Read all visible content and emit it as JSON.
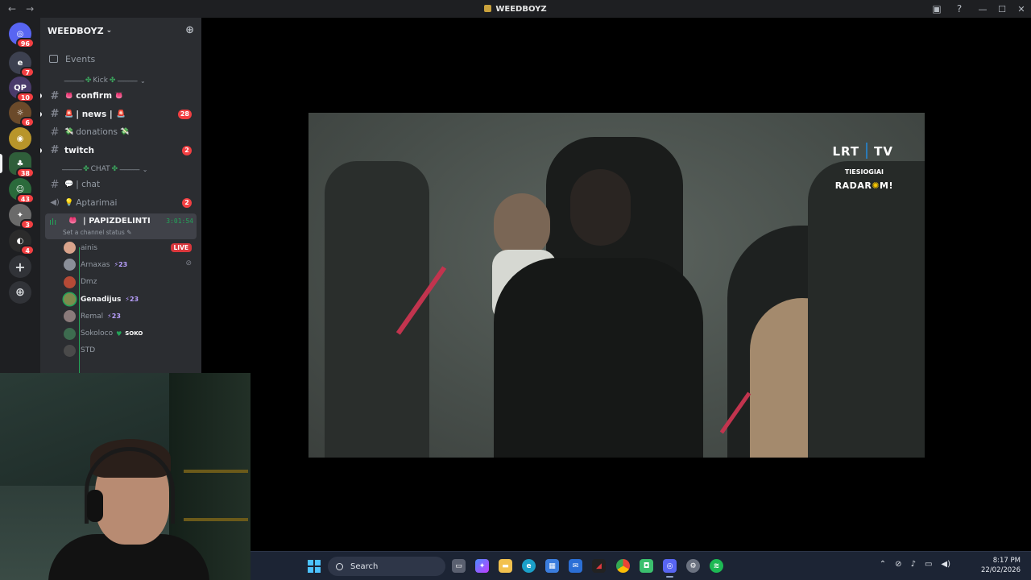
{
  "titlebar": {
    "title": "WEEDBOYZ",
    "back": "←",
    "forward": "→",
    "minimize": "—",
    "maximize": "☐",
    "close": "✕"
  },
  "rail": {
    "servers": [
      {
        "name": "home",
        "badge": "96",
        "color": "#5865f2"
      },
      {
        "name": "server-1",
        "badge": "7",
        "color": "#3d4150"
      },
      {
        "name": "server-2",
        "badge": "10",
        "color": "#4a3b6b"
      },
      {
        "name": "server-3",
        "badge": "6",
        "color": "#6b4a2a"
      },
      {
        "name": "server-4",
        "badge": "",
        "color": "#b8952a"
      },
      {
        "name": "server-5",
        "badge": "38",
        "color": "#2f5e3a"
      },
      {
        "name": "server-6",
        "badge": "43",
        "color": "#2b6a3b"
      },
      {
        "name": "server-7",
        "badge": "3",
        "color": "#6a6a6a"
      },
      {
        "name": "server-8",
        "badge": "4",
        "color": "#2b2b2b"
      }
    ],
    "add": "+",
    "discover": "⊕"
  },
  "sidebar": {
    "guild_name": "WEEDBOYZ",
    "events_label": "Events",
    "categories": [
      {
        "label": "Kick"
      },
      {
        "label": "CHAT"
      }
    ],
    "channels_kick": [
      {
        "name": "confirm",
        "emoji": "👅",
        "emoji2": "👅",
        "unread": true,
        "count": ""
      },
      {
        "name": "| news |",
        "emoji": "🚨",
        "emoji2": "🚨",
        "unread": true,
        "count": "28"
      },
      {
        "name": "donations",
        "emoji": "💸",
        "emoji2": "💸",
        "unread": false,
        "count": ""
      },
      {
        "name": "twitch",
        "emoji": "",
        "emoji2": "",
        "unread": true,
        "count": "2"
      }
    ],
    "channels_chat": [
      {
        "name": "| chat",
        "emoji": "💬",
        "type": "text",
        "count": ""
      },
      {
        "name": "Aptarimai",
        "emoji": "💡",
        "type": "voice",
        "count": "2"
      }
    ],
    "voice_channel": {
      "name": "| PAPIZDELINTI",
      "status": "Set a channel status",
      "timer": "3:01:54"
    },
    "voice_users": [
      {
        "name": "ainis",
        "live": "LIVE",
        "boost": "",
        "tag": "",
        "bright": false,
        "avatar": "#d9a38b"
      },
      {
        "name": "Arnaxas",
        "live": "",
        "boost": "23",
        "tag": "",
        "bright": false,
        "muted": true,
        "avatar": "#8a8f99"
      },
      {
        "name": "Dmz",
        "live": "",
        "boost": "",
        "tag": "",
        "bright": false,
        "avatar": "#b54a36"
      },
      {
        "name": "Genadijus",
        "live": "",
        "boost": "23",
        "tag": "",
        "bright": true,
        "avatar": "#7f8a4d"
      },
      {
        "name": "Remal",
        "live": "",
        "boost": "23",
        "tag": "",
        "bright": false,
        "avatar": "#8a7a7a"
      },
      {
        "name": "Sokoloco",
        "live": "",
        "boost": "",
        "tag": "SOKO",
        "bright": false,
        "avatar": "#3d6b4f"
      },
      {
        "name": "STD",
        "live": "",
        "boost": "",
        "tag": "",
        "bright": false,
        "avatar": "#4a4a4a"
      }
    ]
  },
  "stream": {
    "logo_left": "LRT",
    "logo_right": "TV",
    "overlay_line1": "TIESIOGIAI",
    "overlay_line2_a": "RADAR",
    "overlay_line2_b": "M!"
  },
  "taskbar": {
    "search_placeholder": "Search",
    "apps": [
      "file-explorer-app",
      "copilot-app",
      "folder-app",
      "edge-app",
      "store-app",
      "mail-app",
      "terminal-app",
      "chrome-app",
      "app-green",
      "discord-app",
      "settings-app",
      "spotify-app"
    ],
    "time": "8:17 PM",
    "date": "22/02/2026"
  }
}
